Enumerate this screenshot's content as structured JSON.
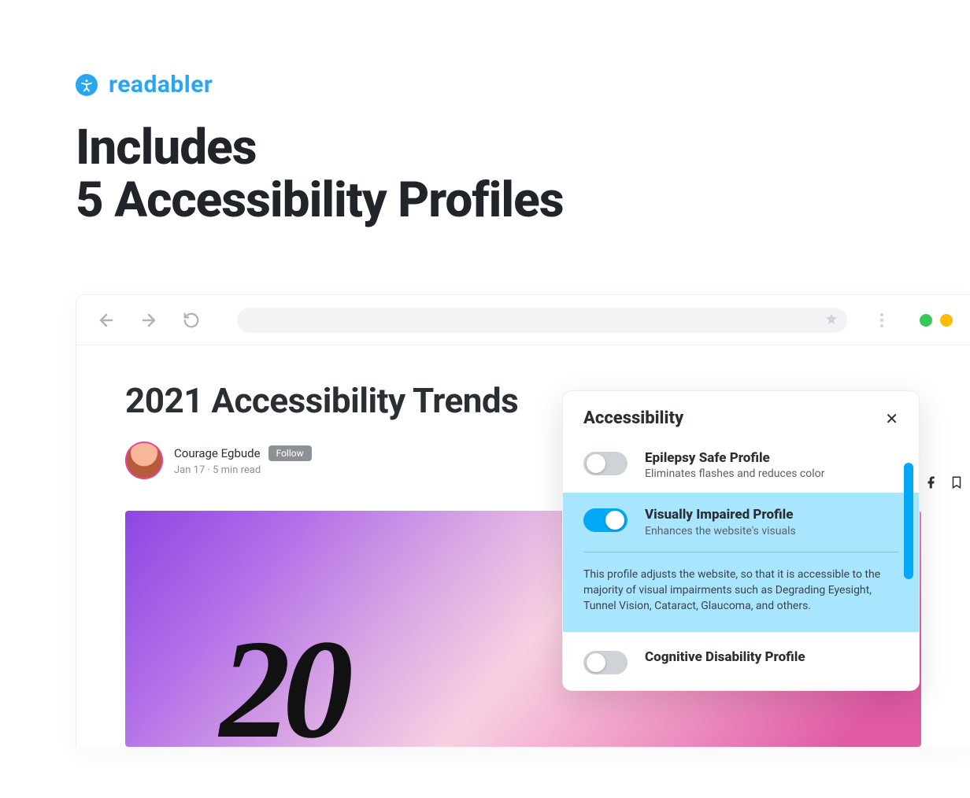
{
  "brand": {
    "name": "readabler"
  },
  "headline": {
    "line1": "Includes",
    "line2": "5 Accessibility Profiles"
  },
  "article": {
    "title": "2021 Accessibility Trends",
    "author": "Courage Egbude",
    "follow_label": "Follow",
    "dateline": "Jan 17 · 5 min read",
    "hero_text": "20"
  },
  "panel": {
    "title": "Accessibility",
    "profiles": [
      {
        "name": "Epilepsy Safe Profile",
        "desc": "Eliminates flashes and reduces color",
        "active": false
      },
      {
        "name": "Visually Impaired Profile",
        "desc": "Enhances the website's visuals",
        "active": true,
        "detail": "This profile adjusts the website, so that it is accessible to the majority of visual impairments such as Degrading Eyesight, Tunnel Vision, Cataract, Glaucoma, and others."
      },
      {
        "name": "Cognitive Disability Profile",
        "desc": "",
        "active": false
      }
    ]
  }
}
